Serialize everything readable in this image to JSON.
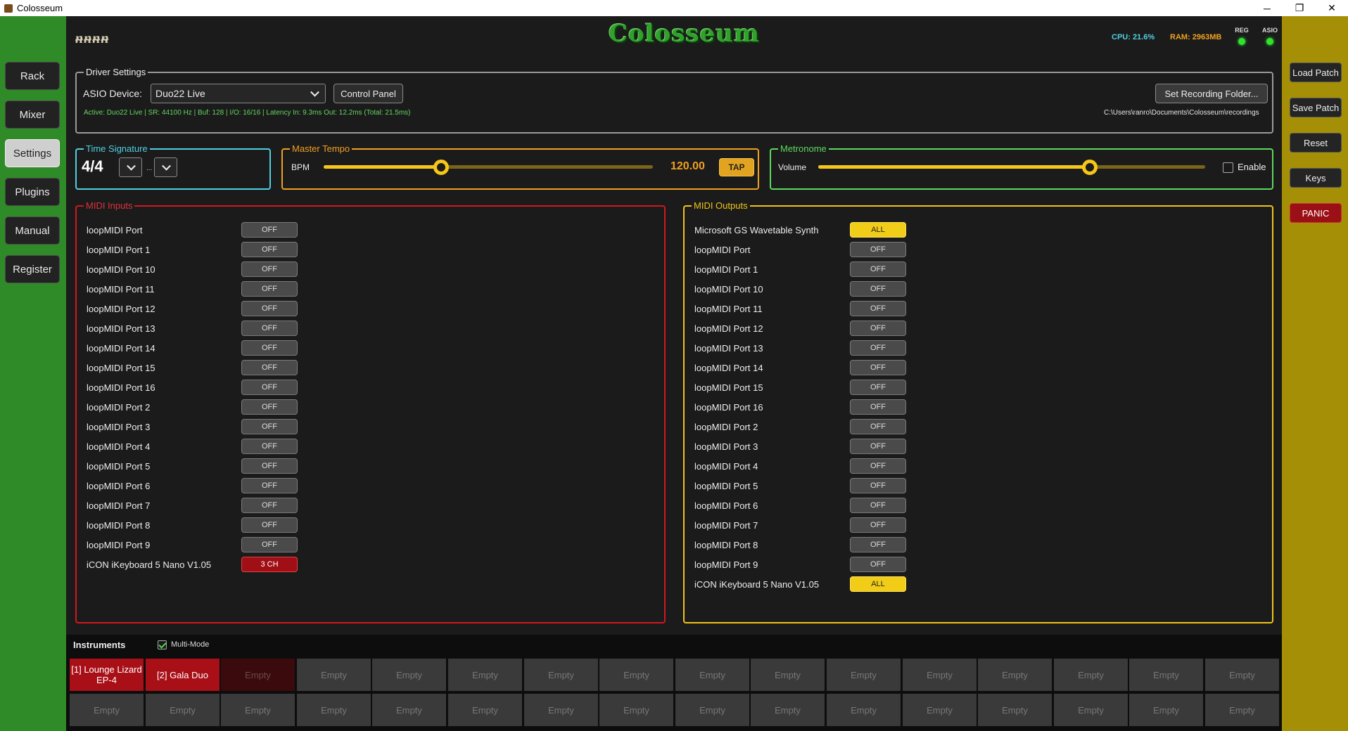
{
  "window": {
    "title": "Colosseum",
    "minimize": "─",
    "maximize": "❐",
    "close": "✕"
  },
  "header": {
    "logo_small": "ᵰᵰᵰᵰ",
    "app_name": "Colosseum",
    "cpu": "CPU: 21.6%",
    "ram": "RAM: 2963MB",
    "reg_label": "REG",
    "asio_label": "ASIO"
  },
  "nav": [
    "Rack",
    "Mixer",
    "Settings",
    "Plugins",
    "Manual",
    "Register"
  ],
  "nav_active": "Settings",
  "right_panel": [
    "Load Patch",
    "Save Patch",
    "Reset",
    "Keys",
    "PANIC"
  ],
  "driver": {
    "legend": "Driver Settings",
    "device_label": "ASIO Device:",
    "device_value": "Duo22 Live",
    "control_panel": "Control Panel",
    "record_button": "Set Recording Folder...",
    "status": "Active: Duo22 Live | SR: 44100 Hz | Buf: 128 | I/O: 16/16 | Latency In: 9.3ms Out: 12.2ms (Total: 21.5ms)",
    "record_path": "C:\\Users\\ranro\\Documents\\Colosseum\\recordings"
  },
  "time_signature": {
    "legend": "Time Signature",
    "value": "4/4",
    "separator": "..."
  },
  "tempo": {
    "legend": "Master Tempo",
    "label": "BPM",
    "value": "120.00",
    "tap": "TAP",
    "fraction": 0.357
  },
  "metronome": {
    "legend": "Metronome",
    "label": "Volume",
    "enable": "Enable",
    "enabled": false,
    "fraction": 0.702
  },
  "midi_inputs": {
    "legend": "MIDI Inputs",
    "ports": [
      {
        "name": "loopMIDI Port",
        "state": "OFF"
      },
      {
        "name": "loopMIDI Port 1",
        "state": "OFF"
      },
      {
        "name": "loopMIDI Port 10",
        "state": "OFF"
      },
      {
        "name": "loopMIDI Port 11",
        "state": "OFF"
      },
      {
        "name": "loopMIDI Port 12",
        "state": "OFF"
      },
      {
        "name": "loopMIDI Port 13",
        "state": "OFF"
      },
      {
        "name": "loopMIDI Port 14",
        "state": "OFF"
      },
      {
        "name": "loopMIDI Port 15",
        "state": "OFF"
      },
      {
        "name": "loopMIDI Port 16",
        "state": "OFF"
      },
      {
        "name": "loopMIDI Port 2",
        "state": "OFF"
      },
      {
        "name": "loopMIDI Port 3",
        "state": "OFF"
      },
      {
        "name": "loopMIDI Port 4",
        "state": "OFF"
      },
      {
        "name": "loopMIDI Port 5",
        "state": "OFF"
      },
      {
        "name": "loopMIDI Port 6",
        "state": "OFF"
      },
      {
        "name": "loopMIDI Port 7",
        "state": "OFF"
      },
      {
        "name": "loopMIDI Port 8",
        "state": "OFF"
      },
      {
        "name": "loopMIDI Port 9",
        "state": "OFF"
      },
      {
        "name": "iCON iKeyboard 5 Nano V1.05",
        "state": "3 CH"
      }
    ]
  },
  "midi_outputs": {
    "legend": "MIDI Outputs",
    "ports": [
      {
        "name": "Microsoft GS Wavetable Synth",
        "state": "ALL"
      },
      {
        "name": "loopMIDI Port",
        "state": "OFF"
      },
      {
        "name": "loopMIDI Port 1",
        "state": "OFF"
      },
      {
        "name": "loopMIDI Port 10",
        "state": "OFF"
      },
      {
        "name": "loopMIDI Port 11",
        "state": "OFF"
      },
      {
        "name": "loopMIDI Port 12",
        "state": "OFF"
      },
      {
        "name": "loopMIDI Port 13",
        "state": "OFF"
      },
      {
        "name": "loopMIDI Port 14",
        "state": "OFF"
      },
      {
        "name": "loopMIDI Port 15",
        "state": "OFF"
      },
      {
        "name": "loopMIDI Port 16",
        "state": "OFF"
      },
      {
        "name": "loopMIDI Port 2",
        "state": "OFF"
      },
      {
        "name": "loopMIDI Port 3",
        "state": "OFF"
      },
      {
        "name": "loopMIDI Port 4",
        "state": "OFF"
      },
      {
        "name": "loopMIDI Port 5",
        "state": "OFF"
      },
      {
        "name": "loopMIDI Port 6",
        "state": "OFF"
      },
      {
        "name": "loopMIDI Port 7",
        "state": "OFF"
      },
      {
        "name": "loopMIDI Port 8",
        "state": "OFF"
      },
      {
        "name": "loopMIDI Port 9",
        "state": "OFF"
      },
      {
        "name": "iCON iKeyboard 5 Nano V1.05",
        "state": "ALL"
      }
    ]
  },
  "instruments": {
    "title": "Instruments",
    "multimode_label": "Multi-Mode",
    "multimode": true,
    "row1": [
      "[1] Lounge Lizard EP-4",
      "[2] Gala Duo",
      "Empty",
      "Empty",
      "Empty",
      "Empty",
      "Empty",
      "Empty",
      "Empty",
      "Empty",
      "Empty",
      "Empty",
      "Empty",
      "Empty",
      "Empty",
      "Empty"
    ],
    "row2": [
      "Empty",
      "Empty",
      "Empty",
      "Empty",
      "Empty",
      "Empty",
      "Empty",
      "Empty",
      "Empty",
      "Empty",
      "Empty",
      "Empty",
      "Empty",
      "Empty",
      "Empty",
      "Empty"
    ]
  },
  "colors": {
    "left_accent": "#2f8a28",
    "right_accent": "#a58f06",
    "gold": "#f6c718",
    "red": "#a00f15",
    "cyan": "#4fd0e0",
    "green": "#5ed85e"
  }
}
